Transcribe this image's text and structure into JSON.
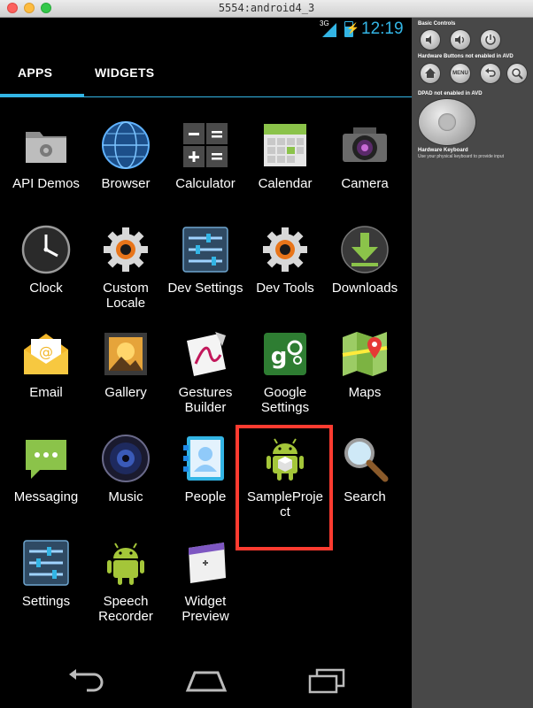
{
  "window": {
    "title": "5554:android4_3"
  },
  "statusbar": {
    "network": "3G",
    "time": "12:19"
  },
  "tabs": [
    {
      "label": "APPS",
      "active": true
    },
    {
      "label": "WIDGETS",
      "active": false
    }
  ],
  "apps": [
    {
      "label": "API Demos"
    },
    {
      "label": "Browser"
    },
    {
      "label": "Calculator"
    },
    {
      "label": "Calendar"
    },
    {
      "label": "Camera"
    },
    {
      "label": "Clock"
    },
    {
      "label": "Custom\nLocale"
    },
    {
      "label": "Dev Settings"
    },
    {
      "label": "Dev Tools"
    },
    {
      "label": "Downloads"
    },
    {
      "label": "Email"
    },
    {
      "label": "Gallery"
    },
    {
      "label": "Gestures\nBuilder"
    },
    {
      "label": "Google\nSettings"
    },
    {
      "label": "Maps"
    },
    {
      "label": "Messaging"
    },
    {
      "label": "Music"
    },
    {
      "label": "People"
    },
    {
      "label": "SampleProje\nct",
      "highlighted": true
    },
    {
      "label": "Search"
    },
    {
      "label": "Settings"
    },
    {
      "label": "Speech\nRecorder"
    },
    {
      "label": "Widget\nPreview"
    }
  ],
  "panel": {
    "basic_controls": "Basic Controls",
    "hardware_buttons": "Hardware Buttons not enabled in AVD",
    "menu_label": "MENU",
    "dpad": "DPAD not enabled in AVD",
    "keyboard": "Hardware Keyboard",
    "keyboard_note": "Use your physical keyboard to provide input"
  },
  "colors": {
    "accent": "#33b5e5",
    "highlight": "#ff3b30",
    "android_green": "#a4c639"
  }
}
